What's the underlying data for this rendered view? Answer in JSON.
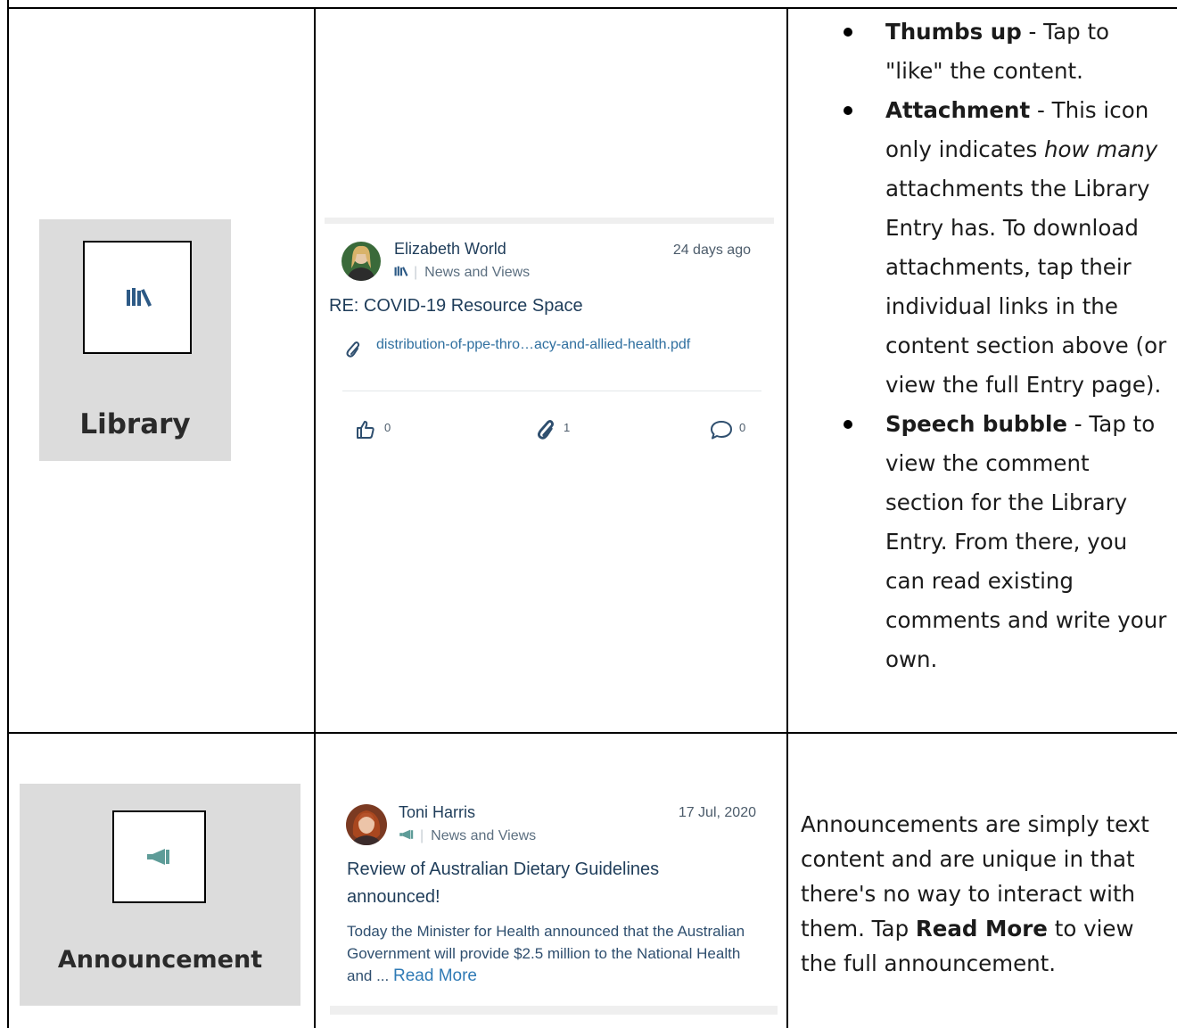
{
  "library_row": {
    "tile_label": "Library",
    "card": {
      "author": "Elizabeth World",
      "time": "24 days ago",
      "category": "News and Views",
      "title": "RE: COVID-19 Resource Space",
      "attachment_name": "distribution-of-ppe-thro…acy-and-allied-health.pdf",
      "likes": "0",
      "attachments": "1",
      "comments": "0"
    },
    "description": {
      "thumbs_term": "Thumbs up",
      "thumbs_text": " - Tap to \"like\" the content.",
      "attach_term": "Attachment",
      "attach_text_1": " - This icon only indicates ",
      "attach_emph": "how many",
      "attach_text_2": " attachments the Library Entry has. To download attachments, tap their individual links in the content section above (or view the full Entry page).",
      "speech_term": "Speech bubble",
      "speech_text": " - Tap to view the comment section for the Library Entry. From there, you can read existing comments and write your own."
    }
  },
  "announcement_row": {
    "tile_label": "Announcement",
    "card": {
      "author": "Toni Harris",
      "time": "17 Jul, 2020",
      "category": "News and Views",
      "title": "Review of Australian Dietary Guidelines announced!",
      "excerpt": "Today the Minister for Health announced that the Australian Government will provide $2.5 million to the National Health and ...",
      "read_more": "Read More"
    },
    "description": {
      "text_1": "Announcements are simply text content and are unique in that there's no way to interact with them. Tap ",
      "bold": "Read More",
      "text_2": " to view the full announcement."
    }
  },
  "colors": {
    "tile_bg": "#dcdcdc",
    "card_title": "#1f3d5a",
    "link": "#2f6f9f",
    "library_icon": "#2d5a86",
    "announcement_icon": "#5e9c98"
  }
}
